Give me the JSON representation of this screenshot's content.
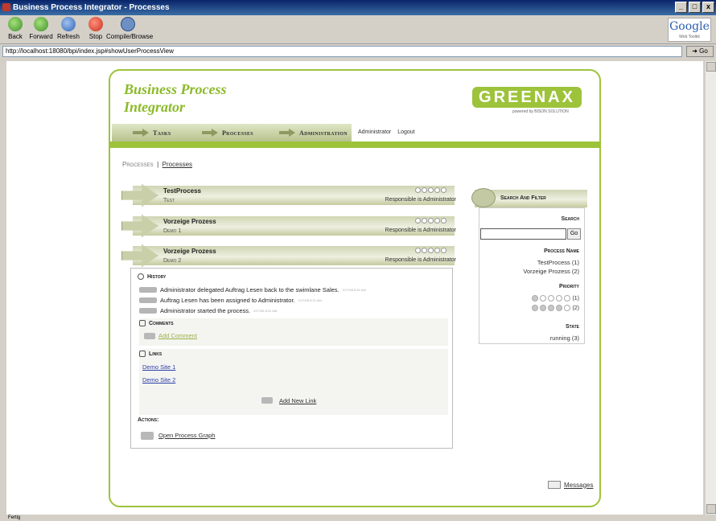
{
  "window": {
    "title": "Business Process Integrator - Processes",
    "buttons": [
      "_",
      "□",
      "x"
    ]
  },
  "toolbar": {
    "back": "Back",
    "forward": "Forward",
    "refresh": "Refresh",
    "stop": "Stop",
    "compile": "Compile/Browse"
  },
  "address": {
    "url": "http://localhost:18080/bpi/index.jsp#showUserProcessView",
    "go_label": "Go"
  },
  "google": {
    "logo": "Google",
    "sub": "Web Toolkit"
  },
  "status": "Fertig",
  "app": {
    "title_line1": "Business Process",
    "title_line2": "Integrator",
    "logo": "GREENAX",
    "logo_sub": "powered by BISON SOLUTION"
  },
  "nav": {
    "tabs": [
      "Tasks",
      "Processes",
      "Administration"
    ],
    "user": "Administrator",
    "logout": "Logout"
  },
  "breadcrumb": {
    "first": "Processes",
    "sep": "|",
    "second": "Processes"
  },
  "processes": [
    {
      "name": "TestProcess",
      "tag": "Test",
      "responsible": "Responsible is Administrator",
      "priority": 1
    },
    {
      "name": "Vorzeige Prozess",
      "tag": "Demo 1",
      "responsible": "Responsible is Administrator",
      "priority": 2
    },
    {
      "name": "Vorzeige Prozess",
      "tag": "Demo 2",
      "responsible": "Responsible is Administrator",
      "priority": 2
    }
  ],
  "details": {
    "history_title": "History",
    "history": [
      {
        "text": "Administrator delegated Auftrag Lesen back to the swimlane Sales.",
        "time": "2/17/08 8:31 AM"
      },
      {
        "text": "Auftrag Lesen has been assigned to Administrator.",
        "time": "2/17/08 8:31 AM"
      },
      {
        "text": "Administrator started the process.",
        "time": "2/17/08 8:31 AM"
      }
    ],
    "comments_title": "Comments",
    "add_comment": "Add Comment",
    "links_title": "Links",
    "links": [
      "Demo Site 1",
      "Demo Site 2"
    ],
    "add_link": "Add New Link",
    "actions_title": "Actions:",
    "open_graph": "Open Process Graph"
  },
  "sidebar": {
    "title": "Search And Filter",
    "search_label": "Search",
    "search_value": "",
    "go": "Go",
    "process_name_label": "Process Name",
    "process_names": [
      "TestProcess  (1)",
      "Vorzeige Prozess  (2)"
    ],
    "priority_label": "Priority",
    "priority_counts": [
      "(1)",
      "(2)"
    ],
    "state_label": "State",
    "state": "running  (3)"
  },
  "messages": "Messages"
}
